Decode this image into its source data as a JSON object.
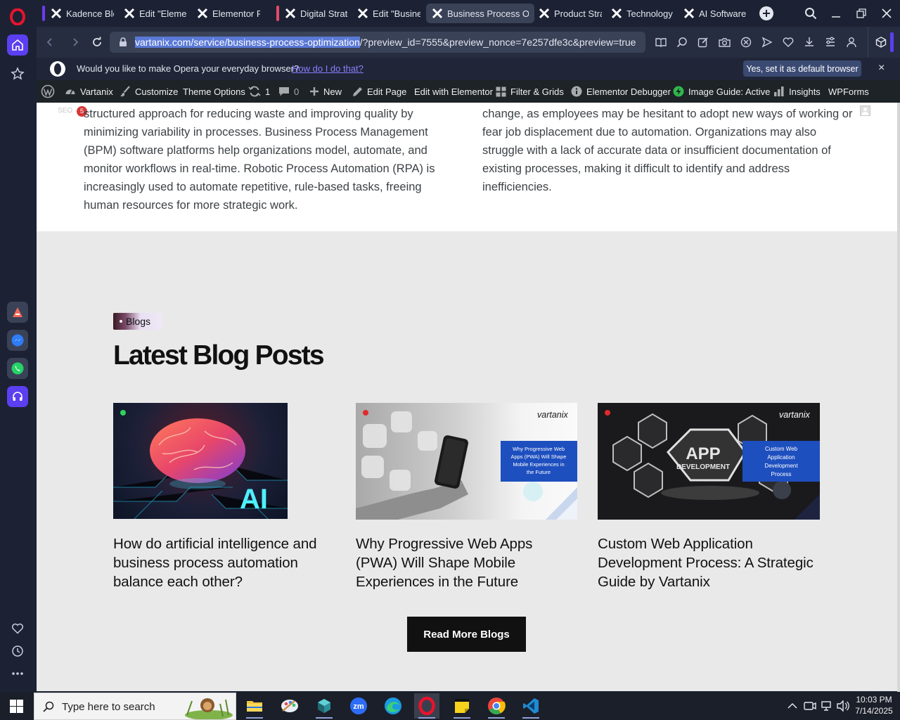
{
  "tabs": [
    {
      "label": "Kadence Block"
    },
    {
      "label": "Edit \"Elemento"
    },
    {
      "label": "Elementor Pag"
    },
    {
      "label": "Digital Strateg"
    },
    {
      "label": "Edit \"Business"
    },
    {
      "label": "Business Process Optim"
    },
    {
      "label": "Product Strate"
    },
    {
      "label": "Technology St"
    },
    {
      "label": "AI Software D"
    }
  ],
  "address": {
    "url_selected": "vartanix.com/service/business-process-optimization",
    "url_rest": "/?preview_id=7555&preview_nonce=7e257dfe3c&preview=true"
  },
  "promo": {
    "question": "Would you like to make Opera your everyday browser?",
    "link": "How do I do that?",
    "button": "Yes, set it as default browser",
    "close": "×"
  },
  "wpbar": {
    "site": "Vartanix",
    "customize": "Customize",
    "theme_options": "Theme Options",
    "updates": "1",
    "comments": "0",
    "new": "New",
    "edit_page": "Edit Page",
    "edit_elementor": "Edit with Elementor",
    "filter_grids": "Filter & Grids",
    "debugger": "Elementor Debugger",
    "image_guide": "Image Guide: Active",
    "insights": "Insights",
    "wpforms": "WPForms",
    "notif_badge": "5",
    "seo_stub": "SEO"
  },
  "article": {
    "left_lines": [
      "structured approach for reducing waste and improving quality by",
      "minimizing variability in processes. Business Process Management",
      "(BPM) software platforms help organizations model, automate, and",
      "monitor workflows in real-time. Robotic Process Automation (RPA) is",
      "increasingly used to automate repetitive, rule-based tasks, freeing",
      "human resources for more strategic work."
    ],
    "right_lines": [
      "change, as employees may be hesitant to adopt new ways of working or",
      "fear job displacement due to automation. Organizations may also",
      "struggle with a lack of accurate data or insufficient documentation of",
      "existing processes, making it difficult to identify and address",
      "inefficiencies."
    ]
  },
  "blog": {
    "tag": "Blogs",
    "heading": "Latest Blog Posts",
    "posts": [
      {
        "title_lines": [
          "How do artificial intelligence and",
          "business process automation",
          "balance each other?"
        ],
        "image_text": "AI"
      },
      {
        "title_lines": [
          "Why Progressive Web Apps",
          "(PWA) Will Shape Mobile",
          "Experiences in the Future"
        ],
        "image_logo": "vartanix",
        "image_caption": [
          "Why Progressive Web",
          "Apps (PWA) Will Shape",
          "Mobile Experiences in",
          "the Future"
        ]
      },
      {
        "title_lines": [
          "Custom Web Application",
          "Development Process: A Strategic",
          "Guide by Vartanix"
        ],
        "image_logo": "vartanix",
        "image_app": [
          "APP",
          "DEVELOPMENT"
        ],
        "image_caption": [
          "Custom Web",
          "Application",
          "Development",
          "Process"
        ]
      }
    ],
    "read_more": "Read More Blogs"
  },
  "taskbar": {
    "search_placeholder": "Type here to search",
    "time": "10:03 PM",
    "date": "7/14/2025"
  },
  "colors": {
    "accent": "#5b3ff0",
    "opera_red": "#e8132d",
    "wp_bar": "#1d2327",
    "button_dark": "#111111"
  }
}
